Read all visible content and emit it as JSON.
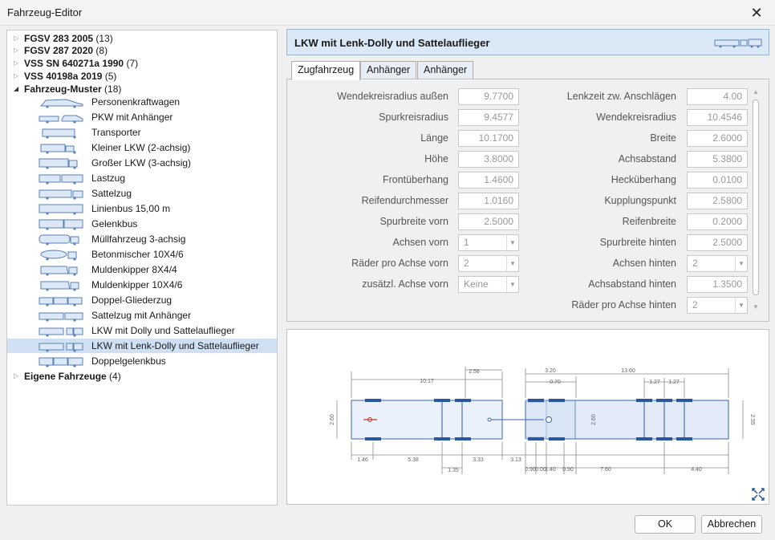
{
  "window": {
    "title": "Fahrzeug-Editor"
  },
  "tree": {
    "groups": [
      {
        "label": "FGSV 283 2005",
        "count": "(13)"
      },
      {
        "label": "FGSV 287 2020",
        "count": "(8)"
      },
      {
        "label": "VSS SN 640271a 1990",
        "count": "(7)"
      },
      {
        "label": "VSS 40198a 2019",
        "count": "(5)"
      },
      {
        "label": "Fahrzeug-Muster",
        "count": "(18)"
      },
      {
        "label": "Eigene Fahrzeuge",
        "count": "(4)"
      }
    ],
    "items": [
      "Personenkraftwagen",
      "PKW mit Anhänger",
      "Transporter",
      "Kleiner LKW (2-achsig)",
      "Großer LKW (3-achsig)",
      "Lastzug",
      "Sattelzug",
      "Linienbus 15,00 m",
      "Gelenkbus",
      "Müllfahrzeug 3-achsig",
      "Betonmischer 10X4/6",
      "Muldenkipper 8X4/4",
      "Muldenkipper 10X4/6",
      "Doppel-Gliederzug",
      "Sattelzug  mit Anhänger",
      "LKW mit Dolly und Sattelauflieger",
      "LKW mit Lenk-Dolly und Sattelauflieger",
      "Doppelgelenkbus"
    ]
  },
  "detail": {
    "title": "LKW mit Lenk-Dolly und Sattelauflieger",
    "tabs": [
      "Zugfahrzeug",
      "Anhänger",
      "Anhänger"
    ],
    "left_fields": [
      {
        "label": "Wendekreisradius außen",
        "value": "9.7700"
      },
      {
        "label": "Spurkreisradius",
        "value": "9.4577"
      },
      {
        "label": "Länge",
        "value": "10.1700"
      },
      {
        "label": "Höhe",
        "value": "3.8000"
      },
      {
        "label": "Frontüberhang",
        "value": "1.4600"
      },
      {
        "label": "Reifendurchmesser",
        "value": "1.0160"
      },
      {
        "label": "Spurbreite vorn",
        "value": "2.5000"
      },
      {
        "label": "Achsen vorn",
        "value": "1"
      },
      {
        "label": "Räder pro Achse vorn",
        "value": "2"
      },
      {
        "label": "zusätzl. Achse vorn",
        "value": "Keine"
      }
    ],
    "right_fields": [
      {
        "label": "Lenkzeit zw. Anschlägen",
        "value": "4.00"
      },
      {
        "label": "Wendekreisradius",
        "value": "10.4546"
      },
      {
        "label": "Breite",
        "value": "2.6000"
      },
      {
        "label": "Achsabstand",
        "value": "5.3800"
      },
      {
        "label": "Hecküberhang",
        "value": "0.0100"
      },
      {
        "label": "Kupplungspunkt",
        "value": "2.5800"
      },
      {
        "label": "Reifenbreite",
        "value": "0.2000"
      },
      {
        "label": "Spurbreite hinten",
        "value": "2.5000"
      },
      {
        "label": "Achsen hinten",
        "value": "2"
      },
      {
        "label": "Achsabstand hinten",
        "value": "1.3500"
      },
      {
        "label": "Räder pro Achse hinten",
        "value": "2"
      }
    ]
  },
  "diagram": {
    "dims_top": [
      "10.17",
      "2.58",
      "3.20",
      "0.70",
      "13.60",
      "1.27",
      "1.27"
    ],
    "dims_bottom": [
      "1.46",
      "5.38",
      "1.35",
      "3.33",
      "3.13",
      "0.90",
      "0.00",
      "1.40",
      "0.90",
      "7.60",
      "4.40"
    ],
    "dims_side": [
      "2.60",
      "2.60",
      "2.55"
    ]
  },
  "buttons": {
    "ok": "OK",
    "cancel": "Abbrechen"
  },
  "colors": {
    "accent": "#2d5fa3",
    "header_bg": "#dbe8f5",
    "selection": "#cfe0f3",
    "vehicle_fill": "#dde8f6",
    "axle": "#2b57a1"
  }
}
